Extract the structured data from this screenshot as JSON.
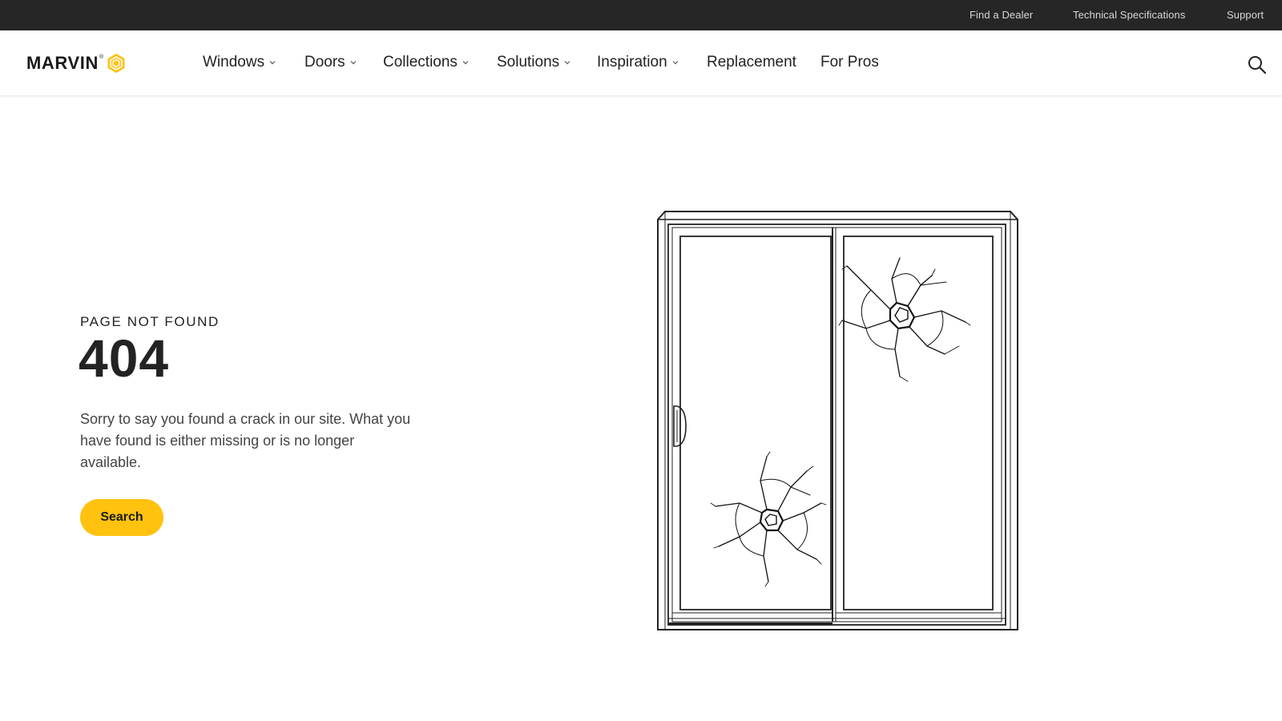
{
  "utility_bar": {
    "links": [
      "Find a Dealer",
      "Technical Specifications",
      "Support"
    ]
  },
  "header": {
    "logo_text": "MARVIN",
    "logo_reg": "®",
    "nav": [
      {
        "label": "Windows",
        "has_dropdown": true
      },
      {
        "label": "Doors",
        "has_dropdown": true
      },
      {
        "label": "Collections",
        "has_dropdown": true
      },
      {
        "label": "Solutions",
        "has_dropdown": true
      },
      {
        "label": "Inspiration",
        "has_dropdown": true
      },
      {
        "label": "Replacement",
        "has_dropdown": false
      },
      {
        "label": "For Pros",
        "has_dropdown": false
      }
    ],
    "search_icon": "search-icon"
  },
  "main": {
    "eyebrow": "PAGE NOT FOUND",
    "code": "404",
    "message": "Sorry to say you found a crack in our site. What you have found is either missing or is no longer available.",
    "button_label": "Search"
  },
  "colors": {
    "utility_bg": "#262626",
    "accent": "#ffc20e",
    "text": "#222222"
  }
}
